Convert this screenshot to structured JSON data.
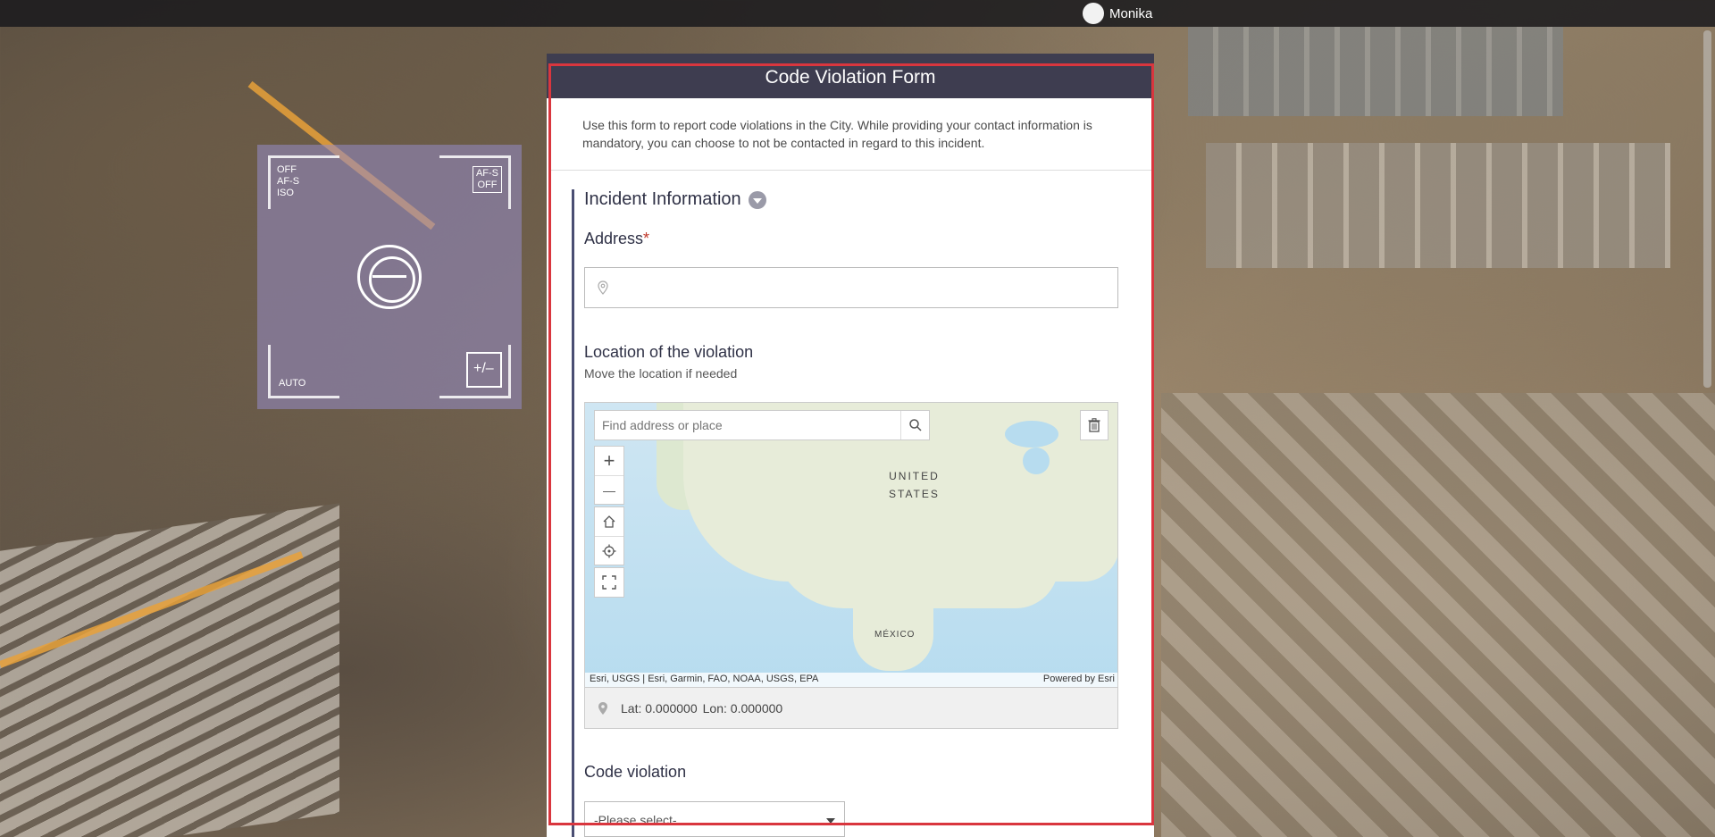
{
  "topbar": {
    "username": "Monika"
  },
  "camera_overlay": {
    "modes": [
      "OFF",
      "AF-S",
      "ISO"
    ],
    "af_badge": [
      "AF-S",
      "OFF"
    ],
    "auto_label": "AUTO",
    "exposure_label": "+/–"
  },
  "form": {
    "title": "Code Violation Form",
    "description": "Use this form to report code violations in the City. While providing your contact information is mandatory, you can choose to not be contacted in regard to this incident.",
    "section_title": "Incident Information",
    "address": {
      "label": "Address",
      "required_mark": "*",
      "value": ""
    },
    "location": {
      "label": "Location of the violation",
      "hint": "Move the location if needed"
    },
    "map": {
      "search_placeholder": "Find address or place",
      "label_country_1": "UNITED",
      "label_country_2": "STATES",
      "label_country_3": "MÉXICO",
      "attribution_left": "Esri, USGS | Esri, Garmin, FAO, NOAA, USGS, EPA",
      "attribution_right": "Powered by Esri",
      "zoom_in": "+",
      "zoom_out": "—"
    },
    "coords": {
      "lat": "Lat: 0.000000",
      "lon": "Lon: 0.000000"
    },
    "code_violation": {
      "label": "Code violation",
      "selected": "-Please select-"
    }
  },
  "colors": {
    "header_bg": "#3e3d50",
    "outline": "#d9363e",
    "section_accent": "#4a4e73",
    "required": "#c0392b"
  }
}
